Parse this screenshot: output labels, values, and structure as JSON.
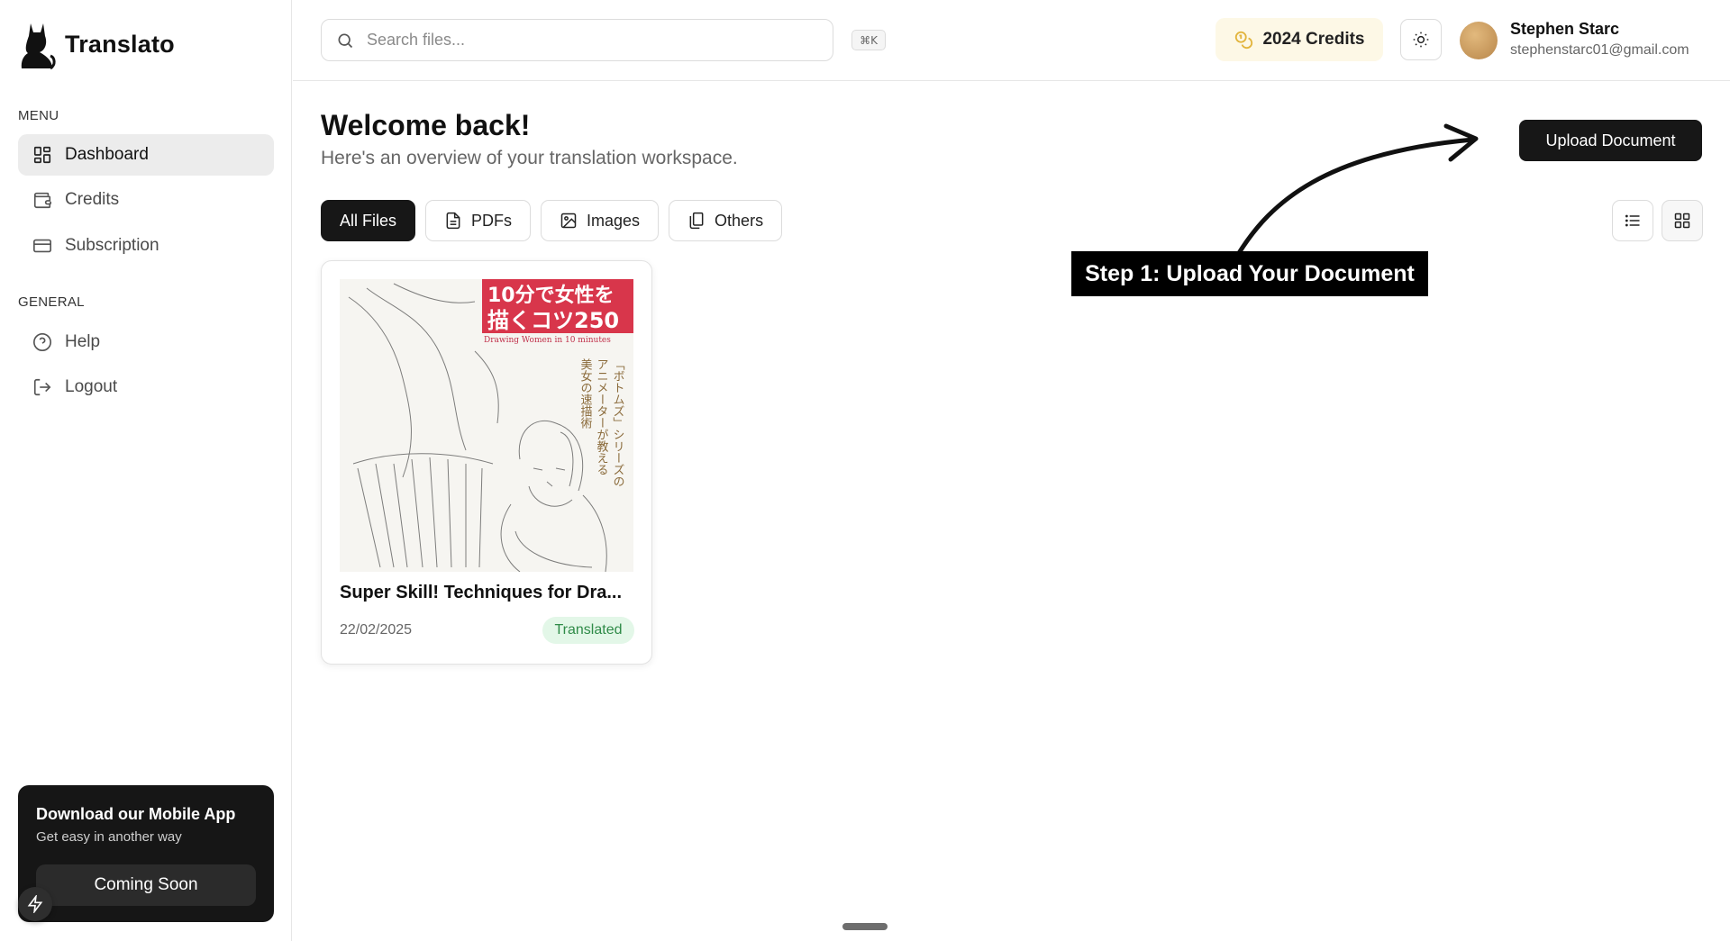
{
  "brand": {
    "name": "Translato"
  },
  "sidebar": {
    "menu_label": "MENU",
    "menu_items": [
      {
        "label": "Dashboard",
        "icon": "dashboard-icon",
        "active": true
      },
      {
        "label": "Credits",
        "icon": "wallet-icon",
        "active": false
      },
      {
        "label": "Subscription",
        "icon": "credit-card-icon",
        "active": false
      }
    ],
    "general_label": "GENERAL",
    "general_items": [
      {
        "label": "Help",
        "icon": "help-circle-icon"
      },
      {
        "label": "Logout",
        "icon": "logout-icon"
      }
    ],
    "promo": {
      "title": "Download our Mobile App",
      "subtitle": "Get easy in another way",
      "button": "Coming Soon"
    }
  },
  "topbar": {
    "search_placeholder": "Search files...",
    "shortcut": "⌘K",
    "credits": "2024 Credits",
    "user": {
      "name": "Stephen Starc",
      "email": "stephenstarc01@gmail.com"
    }
  },
  "main": {
    "title": "Welcome back!",
    "subtitle": "Here's an overview of your translation workspace.",
    "upload_button": "Upload Document",
    "filters": [
      {
        "label": "All Files",
        "icon": "none",
        "active": true
      },
      {
        "label": "PDFs",
        "icon": "file-text-icon",
        "active": false
      },
      {
        "label": "Images",
        "icon": "image-icon",
        "active": false
      },
      {
        "label": "Others",
        "icon": "files-icon",
        "active": false
      }
    ],
    "files": [
      {
        "title": "Super Skill! Techniques for Dra...",
        "date": "22/02/2025",
        "status": "Translated",
        "cover": {
          "headline_line1": "10分で女性を",
          "headline_line2": "描くコツ250",
          "english": "Drawing Women in 10 minutes",
          "vertical_col1": "「ボトムズ」シリーズの",
          "vertical_col2": "アニメーターが教える",
          "vertical_col3": "美女の速描術"
        }
      }
    ]
  },
  "annotation": {
    "text": "Step 1: Upload Your Document"
  },
  "colors": {
    "accent": "#171717",
    "credits_bg": "#fdf8e6",
    "badge_bg": "#e3f7e8",
    "badge_text": "#2f8b48",
    "cover_red": "#d8364b"
  }
}
